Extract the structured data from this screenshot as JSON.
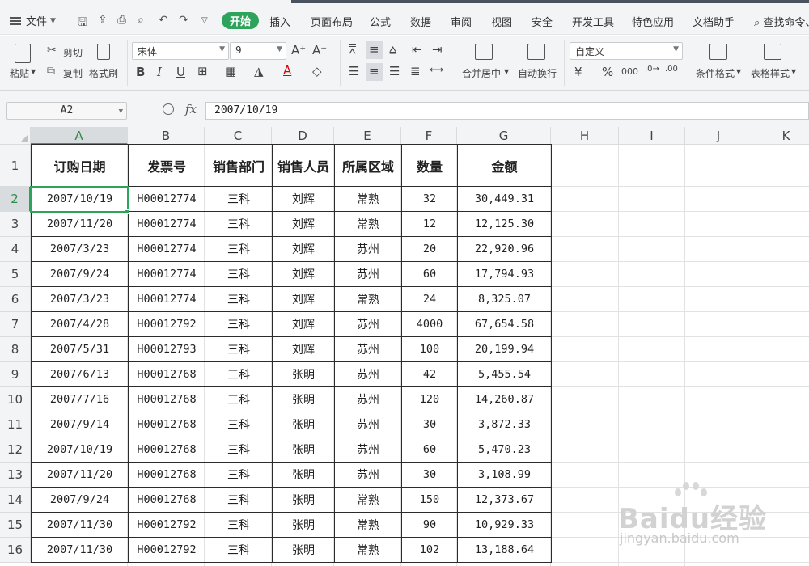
{
  "menubar": {
    "file_label": "文件",
    "tabs": [
      "开始",
      "插入",
      "页面布局",
      "公式",
      "数据",
      "审阅",
      "视图",
      "安全",
      "开发工具",
      "特色应用",
      "文档助手"
    ],
    "active_tab": "开始",
    "search_label": "查找命令、"
  },
  "ribbon": {
    "paste_label": "粘贴",
    "cut_label": "剪切",
    "copy_label": "复制",
    "format_painter_label": "格式刷",
    "font_name": "宋体",
    "font_size": "9",
    "merge_center_label": "合并居中",
    "wrap_text_label": "自动换行",
    "number_format": "自定义",
    "conditional_format_label": "条件格式",
    "table_style_label": "表格样式",
    "accent_color": "#2ea35b"
  },
  "formula_bar": {
    "cell_ref": "A2",
    "fx_label": "fx",
    "value": "2007/10/19"
  },
  "sheet": {
    "columns": [
      "A",
      "B",
      "C",
      "D",
      "E",
      "F",
      "G",
      "H",
      "I",
      "J",
      "K"
    ],
    "rows": [
      "1",
      "2",
      "3",
      "4",
      "5",
      "6",
      "7",
      "8",
      "9",
      "10",
      "11",
      "12",
      "13",
      "14",
      "15",
      "16"
    ],
    "selected_column": "A",
    "selected_row": "2",
    "table": {
      "headers": [
        "订购日期",
        "发票号",
        "销售部门",
        "销售人员",
        "所属区域",
        "数量",
        "金额"
      ],
      "rows": [
        [
          "2007/10/19",
          "H00012774",
          "三科",
          "刘辉",
          "常熟",
          "32",
          "30,449.31"
        ],
        [
          "2007/11/20",
          "H00012774",
          "三科",
          "刘辉",
          "常熟",
          "12",
          "12,125.30"
        ],
        [
          "2007/3/23",
          "H00012774",
          "三科",
          "刘辉",
          "苏州",
          "20",
          "22,920.96"
        ],
        [
          "2007/9/24",
          "H00012774",
          "三科",
          "刘辉",
          "苏州",
          "60",
          "17,794.93"
        ],
        [
          "2007/3/23",
          "H00012774",
          "三科",
          "刘辉",
          "常熟",
          "24",
          "8,325.07"
        ],
        [
          "2007/4/28",
          "H00012792",
          "三科",
          "刘辉",
          "苏州",
          "4000",
          "67,654.58"
        ],
        [
          "2007/5/31",
          "H00012793",
          "三科",
          "刘辉",
          "苏州",
          "100",
          "20,199.94"
        ],
        [
          "2007/6/13",
          "H00012768",
          "三科",
          "张明",
          "苏州",
          "42",
          "5,455.54"
        ],
        [
          "2007/7/16",
          "H00012768",
          "三科",
          "张明",
          "苏州",
          "120",
          "14,260.87"
        ],
        [
          "2007/9/14",
          "H00012768",
          "三科",
          "张明",
          "苏州",
          "30",
          "3,872.33"
        ],
        [
          "2007/10/19",
          "H00012768",
          "三科",
          "张明",
          "苏州",
          "60",
          "5,470.23"
        ],
        [
          "2007/11/20",
          "H00012768",
          "三科",
          "张明",
          "苏州",
          "30",
          "3,108.99"
        ],
        [
          "2007/9/24",
          "H00012768",
          "三科",
          "张明",
          "常熟",
          "150",
          "12,373.67"
        ],
        [
          "2007/11/30",
          "H00012792",
          "三科",
          "张明",
          "常熟",
          "90",
          "10,929.33"
        ],
        [
          "2007/11/30",
          "H00012792",
          "三科",
          "张明",
          "常熟",
          "102",
          "13,188.64"
        ]
      ]
    }
  },
  "watermark": {
    "brand": "Baidu经验",
    "url": "jingyan.baidu.com"
  }
}
